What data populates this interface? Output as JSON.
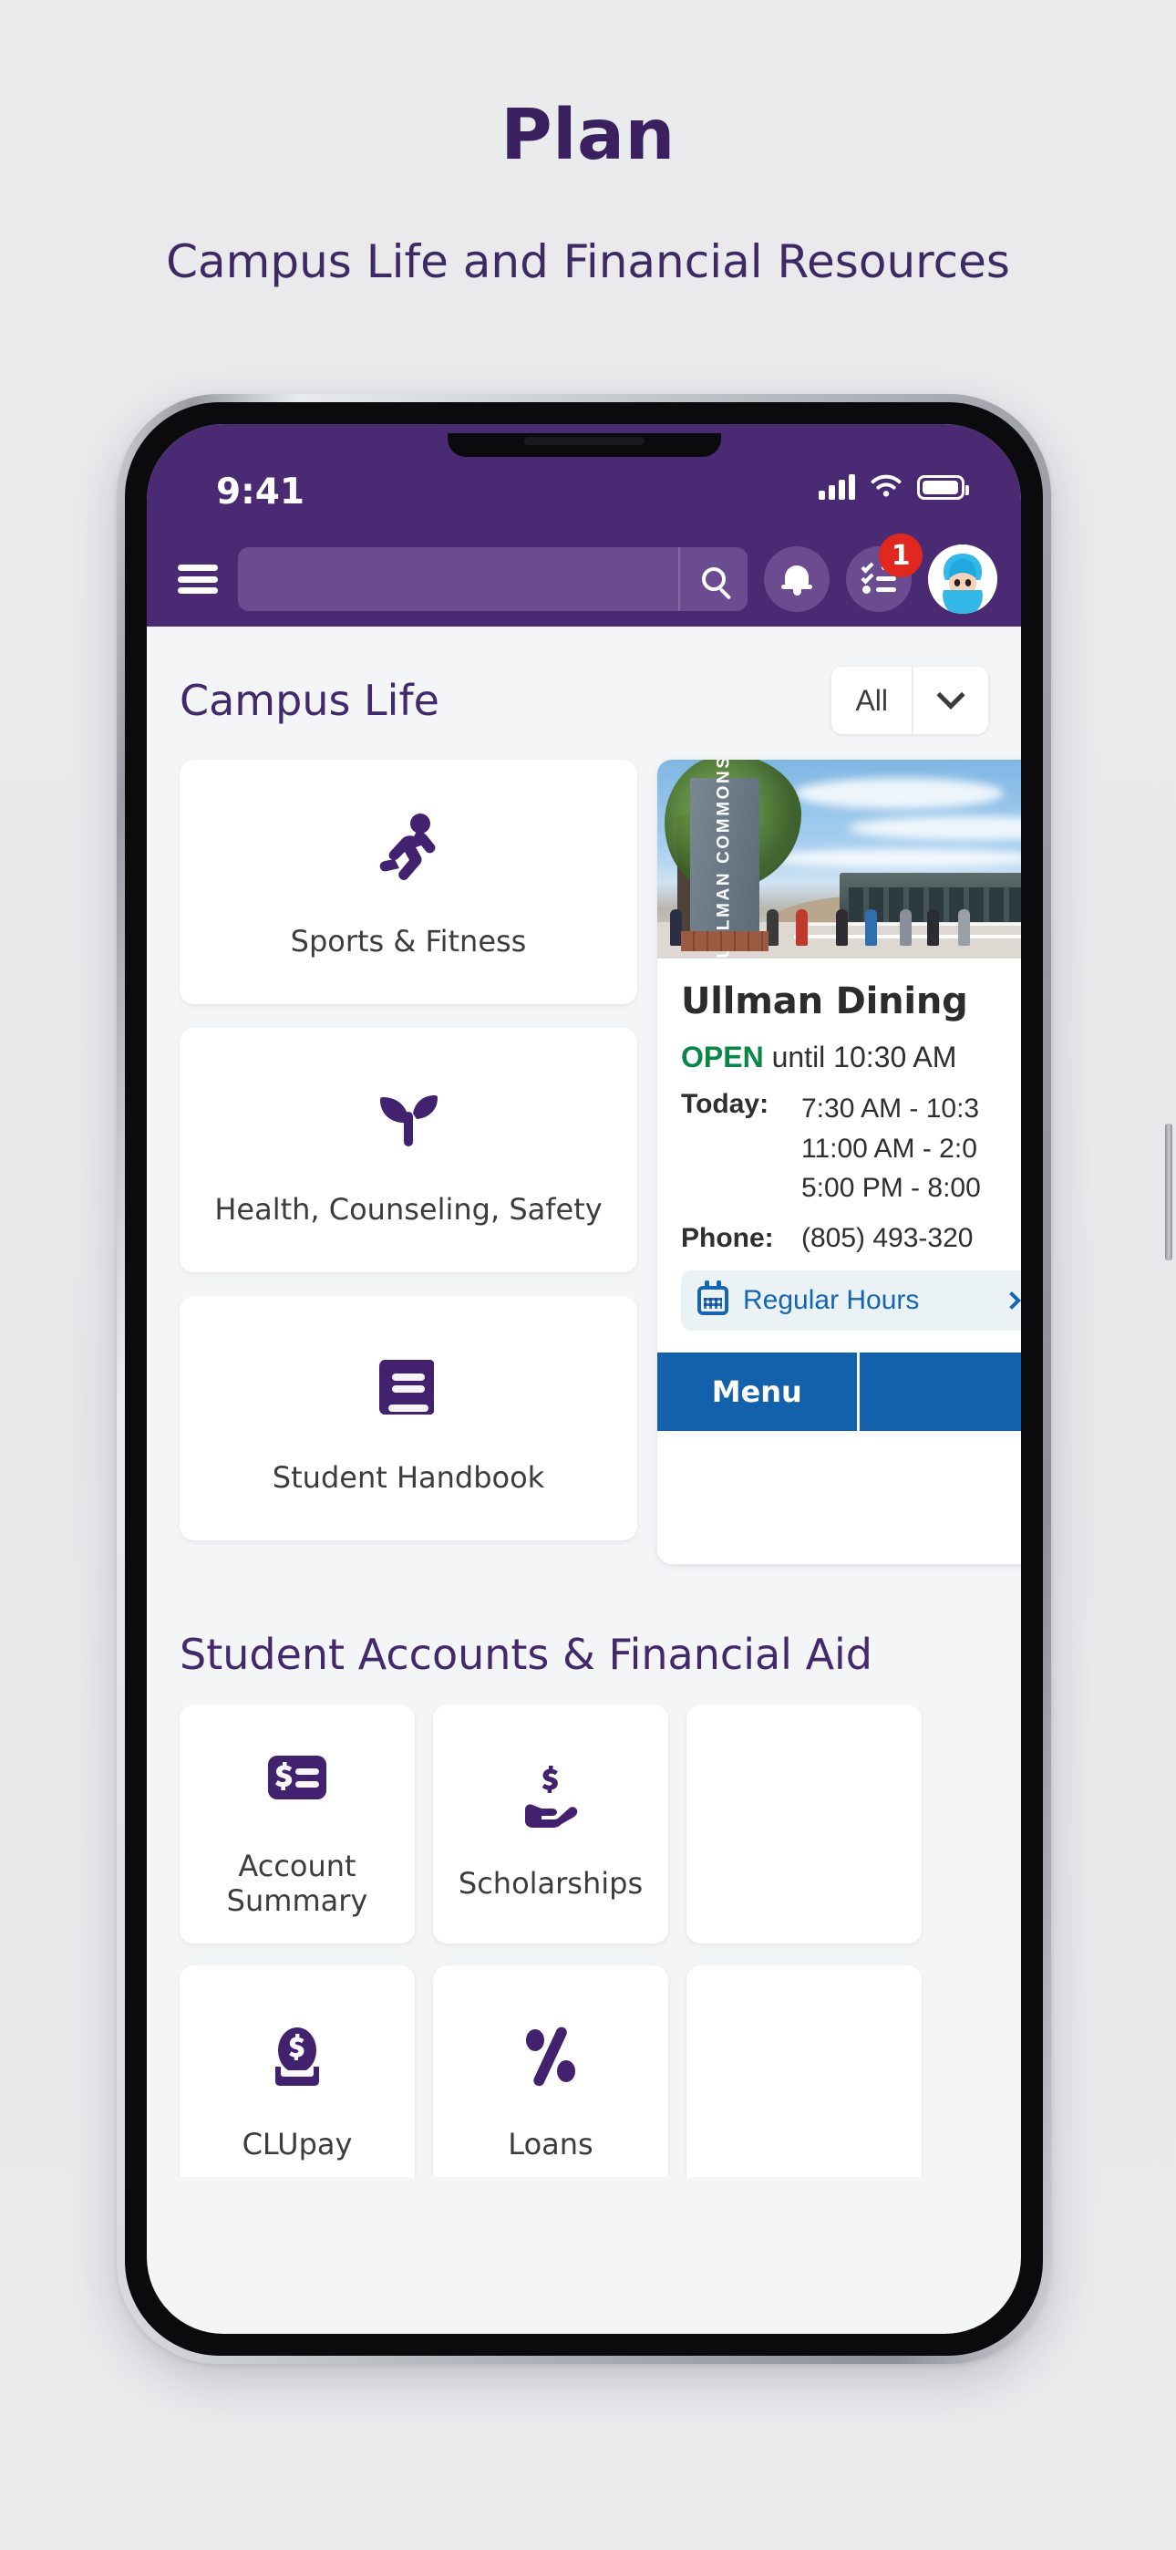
{
  "promo": {
    "title": "Plan",
    "subtitle": "Campus Life and Financial Resources"
  },
  "statusbar": {
    "time": "9:41",
    "signal_icon": "cellular-signal-icon",
    "wifi_icon": "wifi-icon",
    "battery_icon": "battery-icon"
  },
  "appbar": {
    "menu_icon": "hamburger-menu-icon",
    "search_placeholder": "",
    "search_value": "",
    "search_icon": "search-icon",
    "notifications_icon": "bell-icon",
    "tasks_icon": "checklist-icon",
    "tasks_badge": "1",
    "avatar_icon": "user-avatar"
  },
  "campus_life": {
    "section_title": "Campus Life",
    "filter_value": "All",
    "filter_caret_icon": "chevron-down-icon",
    "tiles": [
      {
        "label": "Sports & Fitness",
        "icon": "running-person-icon"
      },
      {
        "label": "Health, Counseling, Safety",
        "icon": "sprout-icon"
      },
      {
        "label": "Student Handbook",
        "icon": "book-icon"
      }
    ]
  },
  "dining_card": {
    "image_sign_text": "ULLMAN COMMONS",
    "title": "Ullman Dining",
    "status_word": "OPEN",
    "status_rest": " until 10:30 AM",
    "today_label": "Today:",
    "today_hours": [
      "7:30 AM - 10:3",
      "11:00 AM - 2:0",
      "5:00 PM - 8:00"
    ],
    "phone_label": "Phone:",
    "phone_value": "(805) 493-320",
    "hours_chip_label": "Regular Hours",
    "hours_chip_icon": "calendar-icon",
    "hours_chip_chevron": "chevron-right-icon",
    "actions": [
      "Menu",
      ""
    ]
  },
  "financial": {
    "section_title": "Student Accounts & Financial Aid",
    "tiles": [
      {
        "label": "Account Summary",
        "icon": "invoice-dollar-icon"
      },
      {
        "label": "Scholarships",
        "icon": "hand-holding-dollar-icon"
      },
      {
        "label": "",
        "icon": ""
      },
      {
        "label": "CLUpay",
        "icon": "coin-deposit-icon"
      },
      {
        "label": "Loans",
        "icon": "percent-icon"
      },
      {
        "label": "",
        "icon": ""
      }
    ]
  },
  "colors": {
    "brand_purple": "#4a2a72",
    "icon_purple": "#42226e",
    "page_bg": "#e8e9eb",
    "screen_bg": "#f4f5f7",
    "open_green": "#0a8648",
    "action_blue": "#1461ab",
    "link_blue": "#1565b5",
    "badge_red": "#e0281f"
  }
}
